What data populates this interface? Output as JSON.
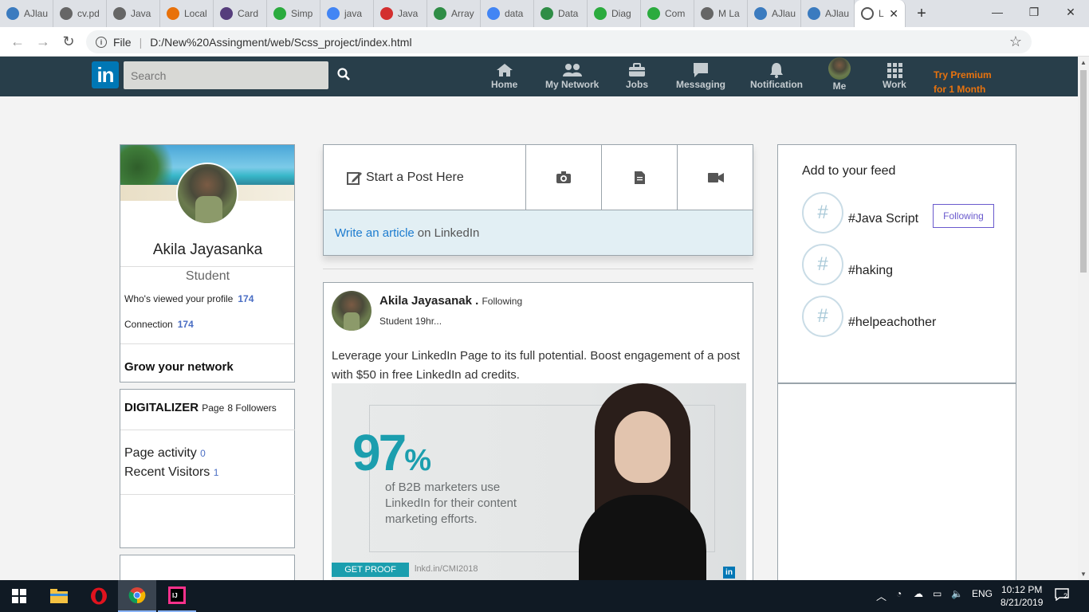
{
  "browser": {
    "tabs": [
      {
        "label": "AJlau",
        "color": "#3b7bbf"
      },
      {
        "label": "cv.pd",
        "color": "#666666"
      },
      {
        "label": "Java",
        "color": "#666666"
      },
      {
        "label": "Local",
        "color": "#e8710a"
      },
      {
        "label": "Card",
        "color": "#563d7c"
      },
      {
        "label": "Simp",
        "color": "#2bab3e"
      },
      {
        "label": "java",
        "color": "#4285f4"
      },
      {
        "label": "Java",
        "color": "#d32f2f"
      },
      {
        "label": "Array",
        "color": "#2f8d46"
      },
      {
        "label": "data",
        "color": "#4285f4"
      },
      {
        "label": "Data",
        "color": "#2f8d46"
      },
      {
        "label": "Diag",
        "color": "#2bab3e"
      },
      {
        "label": "Com",
        "color": "#2bab3e"
      },
      {
        "label": "M La",
        "color": "#666666"
      },
      {
        "label": "AJlau",
        "color": "#3b7bbf"
      },
      {
        "label": "AJlau",
        "color": "#3b7bbf"
      }
    ],
    "active_tab": {
      "label": "L"
    },
    "url_prefix": "File",
    "url": "D:/New%20Assingment/web/Scss_project/index.html"
  },
  "header": {
    "logo": "in",
    "search_placeholder": "Search",
    "nav": [
      {
        "label": "Home",
        "icon": "home-icon"
      },
      {
        "label": "My Network",
        "icon": "network-icon"
      },
      {
        "label": "Jobs",
        "icon": "briefcase-icon"
      },
      {
        "label": "Messaging",
        "icon": "message-icon"
      },
      {
        "label": "Notification",
        "icon": "bell-icon"
      },
      {
        "label": "Me",
        "icon": "avatar"
      },
      {
        "label": "Work",
        "icon": "grid-icon"
      }
    ],
    "premium_line1": "Try Premium",
    "premium_line2": "for 1 Month",
    "premium_color": "#e8730e"
  },
  "profile": {
    "name": "Akila Jayasanka",
    "title": "Student",
    "viewed_label": "Who's viewed your profile",
    "viewed_count": "174",
    "connection_label": "Connection",
    "connection_count": "174",
    "grow_label": "Grow your network"
  },
  "page_card": {
    "name": "DIGITALIZER",
    "page_label": "Page",
    "followers": "8 Followers",
    "activity_label": "Page activity",
    "activity_count": "0",
    "visitors_label": "Recent Visitors",
    "visitors_count": "1"
  },
  "post_box": {
    "start_label": "Start a Post Here",
    "article_link": "Write an article",
    "article_rest": "on LinkedIn"
  },
  "feed_post": {
    "author": "Akila Jayasanak .",
    "following": "Following",
    "meta": "Student 19hr...",
    "text": "Leverage your LinkedIn Page to its full potential. Boost engagement of a post with $50 in free LinkedIn ad credits.",
    "ad_big": "97",
    "ad_pct": "%",
    "ad_line1": "of B2B marketers use",
    "ad_line2": "LinkedIn for their content",
    "ad_line3": "marketing efforts.",
    "ad_cta": "GET PROOF",
    "ad_link": "lnkd.in/CMI2018",
    "ad_logo": "in"
  },
  "feed_sidebar": {
    "title": "Add to your feed",
    "items": [
      {
        "tag": "#Java Script",
        "button": "Following"
      },
      {
        "tag": "#haking"
      },
      {
        "tag": "#helpeachother"
      }
    ]
  },
  "taskbar": {
    "lang": "ENG",
    "time": "10:12 PM",
    "date": "8/21/2019",
    "notif_count": "2"
  }
}
